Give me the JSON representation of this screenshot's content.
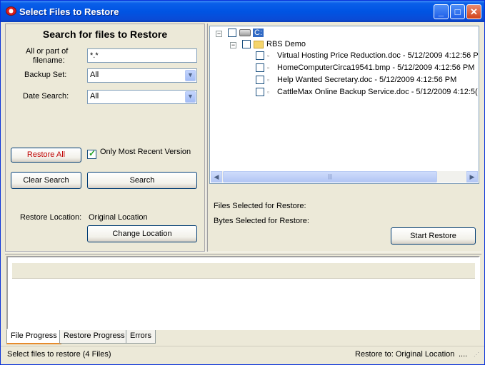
{
  "window": {
    "title": "Select Files to Restore",
    "controls": {
      "minimize": "_",
      "maximize": "□",
      "close": "✕"
    }
  },
  "search_panel": {
    "heading": "Search for files to Restore",
    "filename_label_line1": "All or part of",
    "filename_label_line2": "filename:",
    "filename_value": "*.*",
    "backup_set_label": "Backup Set:",
    "backup_set_value": "All",
    "date_search_label": "Date Search:",
    "date_search_value": "All",
    "restore_all_label": "Restore All",
    "most_recent_label": "Only Most Recent Version",
    "most_recent_checked": true,
    "clear_search_label": "Clear Search",
    "search_label": "Search",
    "restore_location_label": "Restore Location:",
    "restore_location_value": "Original Location",
    "change_location_label": "Change Location"
  },
  "tree": {
    "root": {
      "label": "C:",
      "checked": false
    },
    "folder": {
      "label": "RBS Demo",
      "checked": false
    },
    "files": [
      {
        "label": "Virtual Hosting Price Reduction.doc - 5/12/2009 4:12:56 P"
      },
      {
        "label": "HomeComputerCirca19541.bmp - 5/12/2009 4:12:56 PM"
      },
      {
        "label": "Help Wanted Secretary.doc - 5/12/2009 4:12:56 PM"
      },
      {
        "label": "CattleMax Online Backup Service.doc - 5/12/2009 4:12:5("
      }
    ],
    "expander_minus": "−",
    "scroll_left": "◀",
    "scroll_right": "▶",
    "scroll_grip": "|||"
  },
  "restore_info": {
    "files_selected_label": "Files Selected for Restore:",
    "bytes_selected_label": "Bytes Selected for Restore:",
    "start_restore_label": "Start Restore"
  },
  "tabs": [
    {
      "label": "File Progress",
      "active": true
    },
    {
      "label": "Restore Progress",
      "active": false
    },
    {
      "label": "Errors",
      "active": false
    }
  ],
  "status": {
    "left": "Select files to restore (4 Files)",
    "right": "Restore to: Original Location",
    "ellipsis": "...."
  },
  "icons": {
    "app": "app-icon",
    "dropdown": "chevron-down-icon",
    "drive": "drive-icon",
    "folder": "folder-icon",
    "file": "file-icon",
    "grip": "resize-grip-icon"
  },
  "colors": {
    "titlebar": "#0054e3",
    "button_border": "#003c74",
    "active_tab_accent": "#e68b2c",
    "check": "#21a121"
  }
}
